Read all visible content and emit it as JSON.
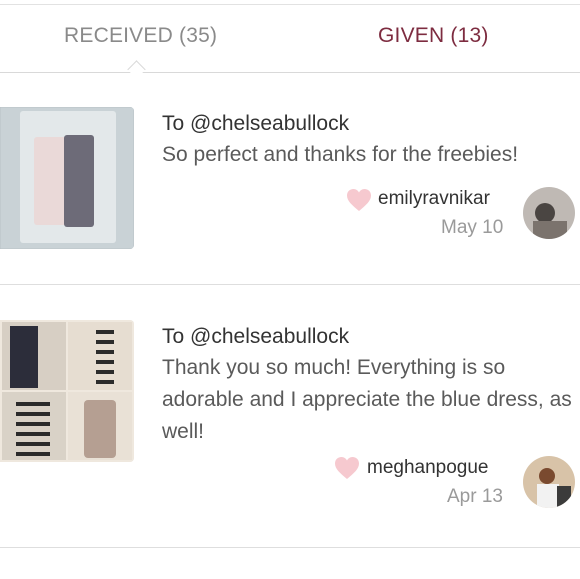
{
  "tabs": {
    "received_label": "RECEIVED",
    "received_count": "(35)",
    "given_label": "GIVEN (13)"
  },
  "notes": [
    {
      "to": "To @chelseabullock",
      "message": "So perfect and thanks for the freebies!",
      "username": "emilyravnikar",
      "date": "May 10"
    },
    {
      "to": "To @chelseabullock",
      "message": "Thank you so much! Everything is so adorable and I appreciate the blue dress, as well!",
      "username": "meghanpogue",
      "date": "Apr 13"
    }
  ],
  "colors": {
    "given_tab": "#7d2c40",
    "heart": "#f6c9cf"
  }
}
